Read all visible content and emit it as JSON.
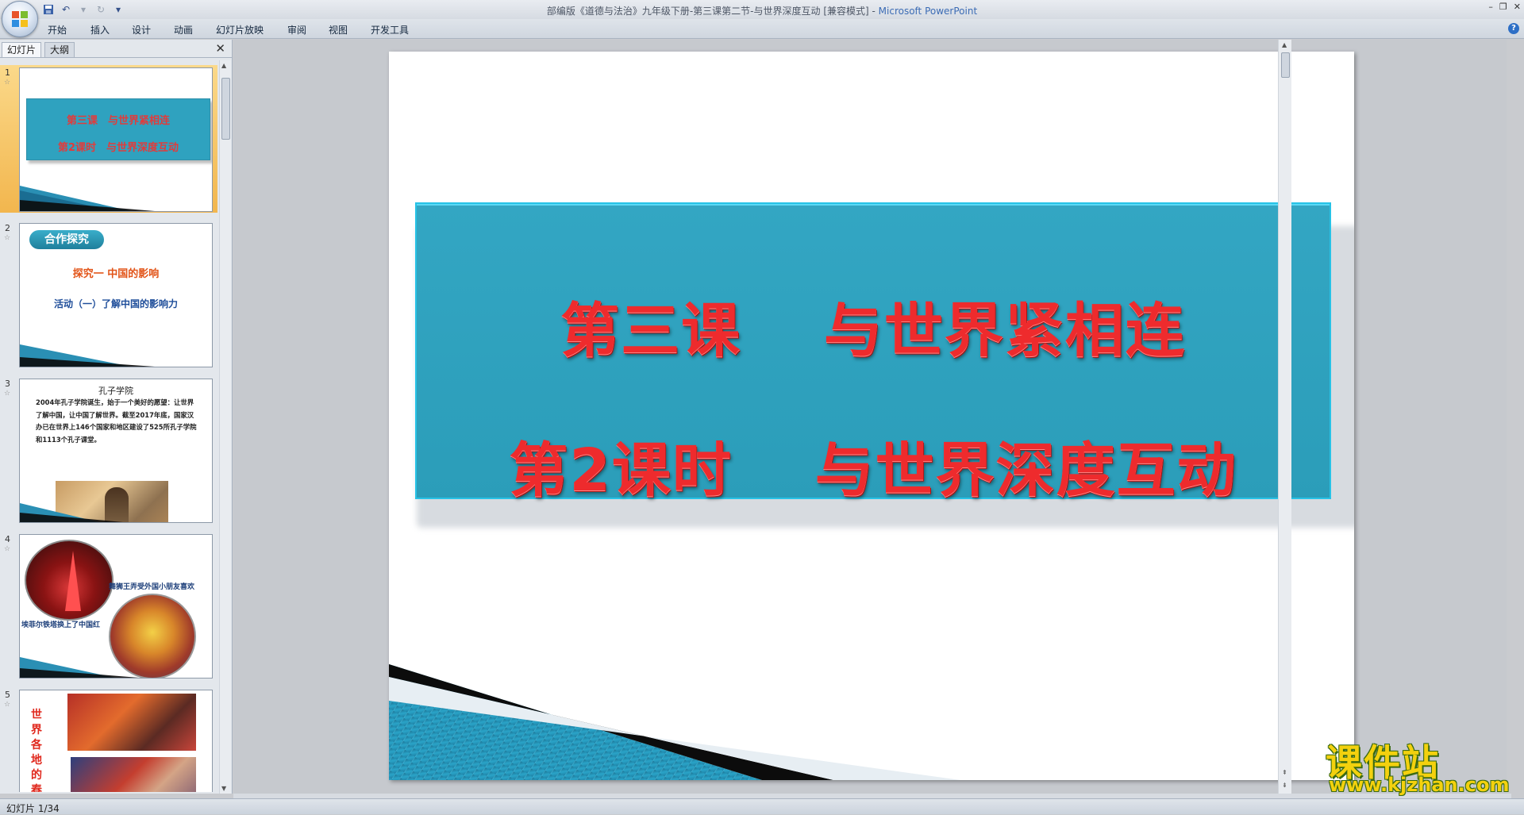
{
  "window": {
    "title": "部编版《道德与法治》九年级下册-第三课第二节-与世界深度互动 [兼容模式] - ",
    "app_name": "Microsoft PowerPoint",
    "controls": [
      "–",
      "❐",
      "✕"
    ]
  },
  "quick_access": {
    "save_icon": "save-icon",
    "undo_icon": "undo-icon",
    "redo_icon": "redo-icon",
    "customize_icon": "dropdown-icon"
  },
  "ribbon": {
    "tabs": [
      "开始",
      "插入",
      "设计",
      "动画",
      "幻灯片放映",
      "审阅",
      "视图",
      "开发工具"
    ],
    "help": "?"
  },
  "left_pane": {
    "tab_slides": "幻灯片",
    "tab_outline": "大纲",
    "close": "✕",
    "thumbnails": [
      {
        "num": "1",
        "line1": "第三课　与世界紧相连",
        "line2": "第2课时　与世界深度互动",
        "selected": true
      },
      {
        "num": "2",
        "badge": "合作探究",
        "sub1": "探究一  中国的影响",
        "sub2": "活动（一）了解中国的影响力"
      },
      {
        "num": "3",
        "title": "孔子学院",
        "text": "2004年孔子学院诞生，始于一个美好的愿望：让世界了解中国，让中国了解世界。截至2017年底，国家汉办已在世界上146个国家和地区建设了525所孔子学院和1113个孔子课堂。"
      },
      {
        "num": "4",
        "caption1": "舞狮王弄受外国小朋友喜欢",
        "caption2": "埃菲尔铁塔换上了中国红"
      },
      {
        "num": "5",
        "vertical_text": "世界各地的春"
      }
    ]
  },
  "slide": {
    "title_line1": "第三课　 与世界紧相连",
    "title_line2": "第2课时　 与世界深度互动"
  },
  "status": {
    "slide_info": "幻灯片 1/34"
  },
  "watermark": {
    "name": "课件站",
    "url": "www.kjzhan.com"
  },
  "colors": {
    "title_box": "#2fa2bf",
    "title_text": "#ee2b2d",
    "selection": "#f2b64e"
  }
}
